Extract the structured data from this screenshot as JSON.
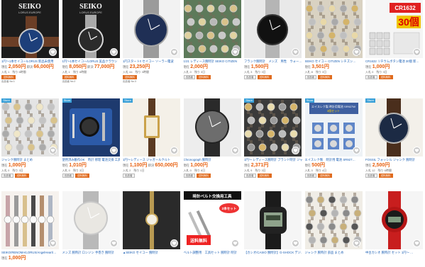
{
  "listings": [
    {
      "id": 1,
      "badge": "",
      "photo": "seiko-chrono-blue",
      "photo_text": "SEIKO",
      "photo_sub": "LORUS EUROPE",
      "title": "1円〜1本セイコー/LORUS 新品未使用",
      "lbl1": "現在",
      "val1": "2,050円",
      "lbl2": "即決",
      "val2": "66,000円",
      "meta": "入札 1　残り 6時間",
      "tags": [
        "送料無料"
      ],
      "note": "出品者 No.1"
    },
    {
      "id": 2,
      "badge": "",
      "photo": "seiko-chrono-silver",
      "photo_text": "SEIKO",
      "photo_sub": "LORUS EUROPE",
      "title": "1円〜1本セイコー/LORUS 美品クラウン",
      "lbl1": "現在",
      "val1": "8,050円",
      "lbl2": "即決",
      "val2": "77,000円",
      "meta": "入札 1　残り 6時間",
      "tags": [
        "送料無料"
      ],
      "note": "出品者 No.2"
    },
    {
      "id": 3,
      "badge": "",
      "photo": "seiko-solar-blue",
      "photo_text": "",
      "photo_sub": "",
      "title": "1円スタート!! セイコー ソーラー電波",
      "lbl1": "現在",
      "val1": "23,250円",
      "lbl2": "",
      "val2": "",
      "meta": "入札 44　残り 3時間",
      "tags": [
        "送料無料"
      ],
      "note": "出品者 No.3"
    },
    {
      "id": 4,
      "badge": "",
      "photo": "watch-pile-green",
      "photo_text": "",
      "photo_sub": "",
      "title": "1/21 レディース腕時計 SEIKO CITIZEN",
      "lbl1": "現在",
      "val1": "2,000円",
      "lbl2": "",
      "val2": "",
      "meta": "入札 0　残り 3日",
      "tags": [
        "出品者",
        "送料無料"
      ],
      "note": ""
    },
    {
      "id": 5,
      "badge": "",
      "photo": "diver-black",
      "photo_text": "",
      "photo_sub": "",
      "title": "フランク腕時計　メンズ　男性　ウォー…",
      "lbl1": "現在",
      "val1": "1,500円",
      "lbl2": "",
      "val2": "",
      "meta": "入札 3　残り 3日",
      "tags": [
        "出品者",
        "送料無料"
      ],
      "note": ""
    },
    {
      "id": 6,
      "badge": "",
      "photo": "watch-pile-mixed",
      "photo_text": "",
      "photo_sub": "",
      "title": "SEIKO セイコー CITIZEN シチズン…",
      "lbl1": "現在",
      "val1": "3,501円",
      "lbl2": "",
      "val2": "",
      "meta": "入札 8　残り 3日",
      "tags": [
        "出品者",
        "送料無料"
      ],
      "note": ""
    },
    {
      "id": 7,
      "badge": "",
      "photo": "battery-pack",
      "photo_text": "CR1632",
      "photo_sub": "30個",
      "title": "CR1632 リチウムボタン電池 30個 新…",
      "lbl1": "現在",
      "val1": "1,000円",
      "lbl2": "",
      "val2": "",
      "meta": "入札 0　残り 3日",
      "tags": [
        "出品者",
        "送料無料"
      ],
      "note": ""
    },
    {
      "id": 8,
      "badge": "Store",
      "photo": "watch-pile-silver",
      "photo_text": "",
      "photo_sub": "",
      "title": "ジャンク腕時計 まとめ",
      "lbl1": "現在",
      "val1": "1,000円",
      "lbl2": "",
      "val2": "",
      "meta": "入札 0　残り 3日",
      "tags": [
        "出品者",
        "送料無料"
      ],
      "note": ""
    },
    {
      "id": 9,
      "badge": "Store",
      "photo": "tool-kit-blue",
      "photo_text": "",
      "photo_sub": "",
      "title": "使用済み動作OK　時計 修理 電池交換 工具",
      "lbl1": "現在",
      "val1": "1,010円",
      "lbl2": "",
      "val2": "",
      "meta": "入札 0　残り 3日",
      "tags": [
        "出品者",
        "送料無料"
      ],
      "note": ""
    },
    {
      "id": 10,
      "badge": "Store",
      "photo": "gold-tank",
      "photo_text": "",
      "photo_sub": "",
      "title": "1円〜レディース ジャガールクルト",
      "lbl1": "現在",
      "val1": "1,100円",
      "lbl2": "即決",
      "val2": "650,000円",
      "meta": "入札 2　残り 1日",
      "tags": [
        "出品者"
      ],
      "note": ""
    },
    {
      "id": 11,
      "badge": "",
      "photo": "chrono-black-grey",
      "photo_text": "",
      "photo_sub": "",
      "title": "Chronograph 腕時計",
      "lbl1": "現在",
      "val1": "1,000円",
      "lbl2": "",
      "val2": "",
      "meta": "入札 0　残り 6日",
      "tags": [
        "出品者",
        "送料無料"
      ],
      "note": ""
    },
    {
      "id": 12,
      "badge": "Store",
      "photo": "watch-pile-dark",
      "photo_text": "",
      "photo_sub": "",
      "title": "1円〜 レディース腕時計 ブランド時計 ジャ…",
      "lbl1": "現在",
      "val1": "2,371円",
      "lbl2": "",
      "val2": "",
      "meta": "入札 9　残り 3日",
      "tags": [
        "出品者",
        "送料無料"
      ],
      "note": ""
    },
    {
      "id": 13,
      "badge": "Store",
      "photo": "battery-blister",
      "photo_text": "エイスレク製 時計用電池 SR927W",
      "photo_sub": "3個セット",
      "title": "エイスレク製　時計用 電池 SR927…",
      "lbl1": "現在",
      "val1": "500円",
      "lbl2": "",
      "val2": "",
      "meta": "入札 0　残り 4日",
      "tags": [
        "出品者",
        "送料無料"
      ],
      "note": ""
    },
    {
      "id": 14,
      "badge": "Store",
      "photo": "fossil-brown",
      "photo_text": "",
      "photo_sub": "",
      "title": "FOSSIL フォッシル ジャンク 腕時計",
      "lbl1": "現在",
      "val1": "2,500円",
      "lbl2": "",
      "val2": "",
      "meta": "入札 12　残り 6時間",
      "tags": [
        "出品者",
        "送料無料"
      ],
      "note": ""
    },
    {
      "id": 15,
      "badge": "",
      "photo": "ladies-pile",
      "photo_text": "",
      "photo_sub": "",
      "title": "SEIKO/RENOMA/LORUS/AngelHeart/…",
      "lbl1": "現在",
      "val1": "1,000円",
      "lbl2": "",
      "val2": "",
      "meta": "",
      "tags": [],
      "note": ""
    },
    {
      "id": 16,
      "badge": "",
      "photo": "silver-dress",
      "photo_text": "",
      "photo_sub": "",
      "title": "メンズ 腕時計 ロンジン 手巻き 腕時計",
      "lbl1": "",
      "val1": "",
      "lbl2": "",
      "val2": "",
      "meta": "",
      "tags": [],
      "note": ""
    },
    {
      "id": 17,
      "badge": "",
      "photo": "gold-ladies",
      "photo_text": "",
      "photo_sub": "",
      "title": "▲SEIKO セイコー 腕時計",
      "lbl1": "",
      "val1": "",
      "lbl2": "",
      "val2": "",
      "meta": "",
      "tags": [],
      "note": ""
    },
    {
      "id": 18,
      "badge": "",
      "photo": "band-tool-ad",
      "photo_text": "時計ベルト交換用工具",
      "photo_sub": "2本セット",
      "photo_extra": "送料無料",
      "title": "ベルト調整用　工具セット 腕時計 時計",
      "lbl1": "",
      "val1": "",
      "lbl2": "",
      "val2": "",
      "meta": "",
      "tags": [],
      "note": ""
    },
    {
      "id": 19,
      "badge": "",
      "photo": "gshock-black",
      "photo_text": "",
      "photo_sub": "",
      "title": "【カシオ/CASIO 腕時計】G-SHOCK デジ…",
      "lbl1": "",
      "val1": "",
      "lbl2": "",
      "val2": "",
      "meta": "",
      "tags": [],
      "note": ""
    },
    {
      "id": 20,
      "badge": "",
      "photo": "parts-pile",
      "photo_text": "",
      "photo_sub": "",
      "title": "ジャンク 腕時計 部品 まとめ",
      "lbl1": "",
      "val1": "",
      "lbl2": "",
      "val2": "",
      "meta": "",
      "tags": [],
      "note": ""
    },
    {
      "id": 21,
      "badge": "",
      "photo": "sport-red",
      "photo_text": "",
      "photo_sub": "",
      "title": "中古カシオ 腕時計 セット 1円〜 …",
      "lbl1": "",
      "val1": "",
      "lbl2": "",
      "val2": "",
      "meta": "",
      "tags": [],
      "note": ""
    }
  ],
  "colors": {
    "accent": "#1a5fb4",
    "price": "#e8600f",
    "badge": "#3aa0d8",
    "tag_hot": "#e06b1e"
  },
  "icons": {
    "favorite": "heart-icon"
  }
}
